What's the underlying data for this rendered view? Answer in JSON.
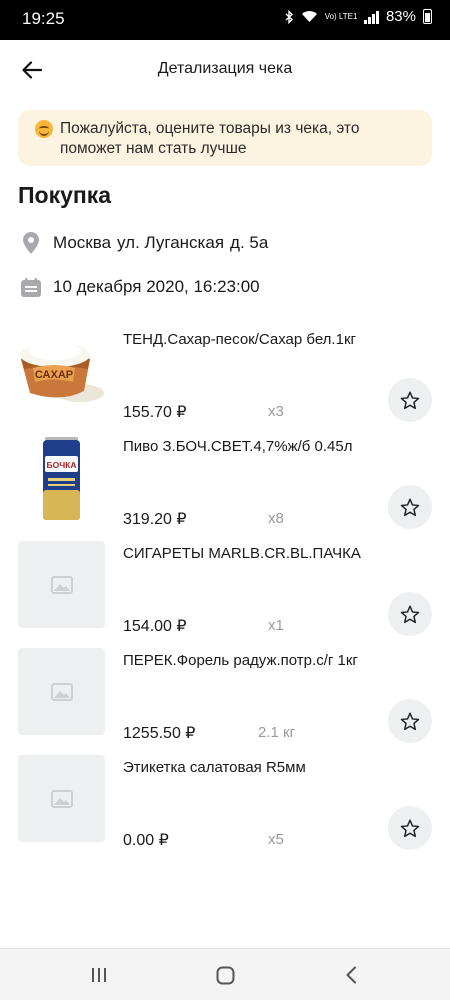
{
  "status_bar": {
    "time": "19:25",
    "network": "Vo) LTE1",
    "battery": "83%"
  },
  "header": {
    "title": "Детализация чека"
  },
  "banner": {
    "text": "Пожалуйста, оцените товары из чека, это поможет нам стать лучше"
  },
  "section_title": "Покупка",
  "address": {
    "city": "Москва",
    "street": "ул. Луганская",
    "house": "д. 5а"
  },
  "datetime": "10 декабря 2020, 16:23:00",
  "items": [
    {
      "name": "ТЕНД.Сахар-песок/Сахар бел.1кг",
      "price": "155.70 ₽",
      "qty": "x3",
      "image": "sugar-bowl"
    },
    {
      "name": "Пиво З.БОЧ.СВЕТ.4,7%ж/б 0.45л",
      "price": "319.20 ₽",
      "qty": "x8",
      "image": "beer-can"
    },
    {
      "name": "СИГАРЕТЫ MARLB.CR.BL.ПАЧКА",
      "price": "154.00 ₽",
      "qty": "x1",
      "image": "placeholder"
    },
    {
      "name": "ПЕРЕК.Форель радуж.потр.с/г 1кг",
      "price": "1255.50 ₽",
      "qty": "2.1 кг",
      "image": "placeholder"
    },
    {
      "name": "Этикетка салатовая R5мм",
      "price": "0.00 ₽",
      "qty": "x5",
      "image": "placeholder"
    }
  ],
  "thumb_labels": {
    "sugar": "САХАР",
    "beer": "БОЧКА"
  },
  "colors": {
    "banner_bg": "#fdf3e1",
    "placeholder_bg": "#eeeff1",
    "muted_text": "#9a9a9a"
  }
}
